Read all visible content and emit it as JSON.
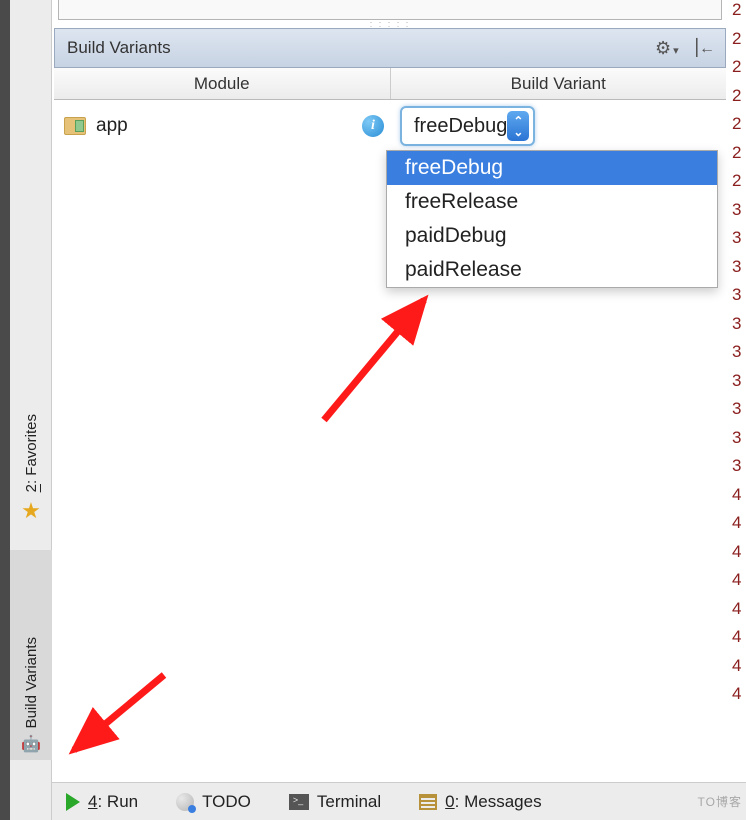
{
  "panel": {
    "title": "Build Variants"
  },
  "columns": {
    "module": "Module",
    "variant": "Build Variant"
  },
  "row": {
    "module_name": "app",
    "selected_variant": "freeDebug"
  },
  "dropdown_options": [
    "freeDebug",
    "freeRelease",
    "paidDebug",
    "paidRelease"
  ],
  "left_tabs": {
    "favorites": {
      "number": "2",
      "label": ": Favorites"
    },
    "build_variants": {
      "label": "Build Variants"
    }
  },
  "bottom_bar": {
    "run": {
      "number": "4",
      "label": ": Run"
    },
    "todo": "TODO",
    "terminal": "Terminal",
    "messages": {
      "number": "0",
      "label": ": Messages"
    }
  },
  "gutter_numbers": [
    "2",
    "2",
    "2",
    "2",
    "2",
    "2",
    "2",
    "3",
    "3",
    "3",
    "3",
    "3",
    "3",
    "3",
    "3",
    "3",
    "3",
    "4",
    "4",
    "4",
    "4",
    "4",
    "4",
    "4",
    "4"
  ],
  "watermark": "TO博客"
}
